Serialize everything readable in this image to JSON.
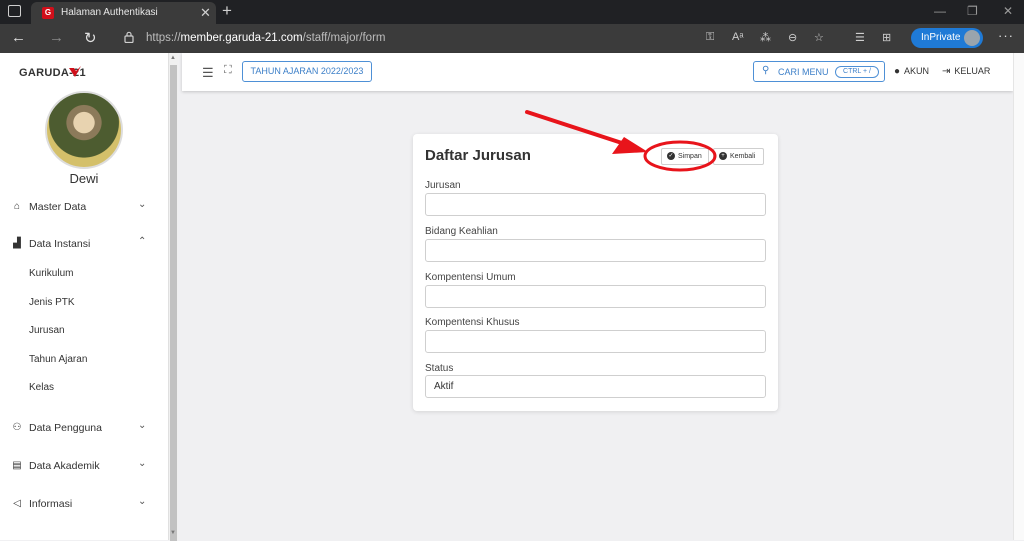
{
  "browser": {
    "tab_title": "Halaman Authentikasi",
    "tab_close": "✕",
    "new_tab": "+",
    "url_prefix": "https://",
    "url_host": "member.garuda-21.com",
    "url_path": "/staff/major/form",
    "inprivate_label": "InPrivate",
    "more": "···",
    "minimize": "—",
    "restore": "❐",
    "close": "✕"
  },
  "sidebar": {
    "brand": "GARUDA-21",
    "username": "Dewi",
    "menu": [
      {
        "label": "Master Data",
        "icon": "home-icon",
        "chevron": "⌄"
      },
      {
        "label": "Data Instansi",
        "icon": "building-icon",
        "chevron": "⌃"
      },
      {
        "label": "Data Pengguna",
        "icon": "user-icon",
        "chevron": "⌄"
      },
      {
        "label": "Data Akademik",
        "icon": "book-icon",
        "chevron": "⌄"
      },
      {
        "label": "Informasi",
        "icon": "megaphone-icon",
        "chevron": "⌄"
      }
    ],
    "submenu": [
      "Kurikulum",
      "Jenis PTK",
      "Jurusan",
      "Tahun Ajaran",
      "Kelas"
    ]
  },
  "appbar": {
    "year_button": "TAHUN AJARAN 2022/2023",
    "search_label": "CARI MENU",
    "search_shortcut": "CTRL + /",
    "account_label": "AKUN",
    "logout_label": "KELUAR"
  },
  "form": {
    "title": "Daftar Jurusan",
    "save_label": "Simpan",
    "back_label": "Kembali",
    "fields": [
      {
        "label": "Jurusan",
        "value": ""
      },
      {
        "label": "Bidang Keahlian",
        "value": ""
      },
      {
        "label": "Kompentensi Umum",
        "value": ""
      },
      {
        "label": "Kompentensi Khusus",
        "value": ""
      },
      {
        "label": "Status",
        "value": "Aktif"
      }
    ]
  },
  "colors": {
    "accent": "#3c7fc8",
    "annotation": "#e8141b",
    "inprivate": "#1f7ad6"
  }
}
